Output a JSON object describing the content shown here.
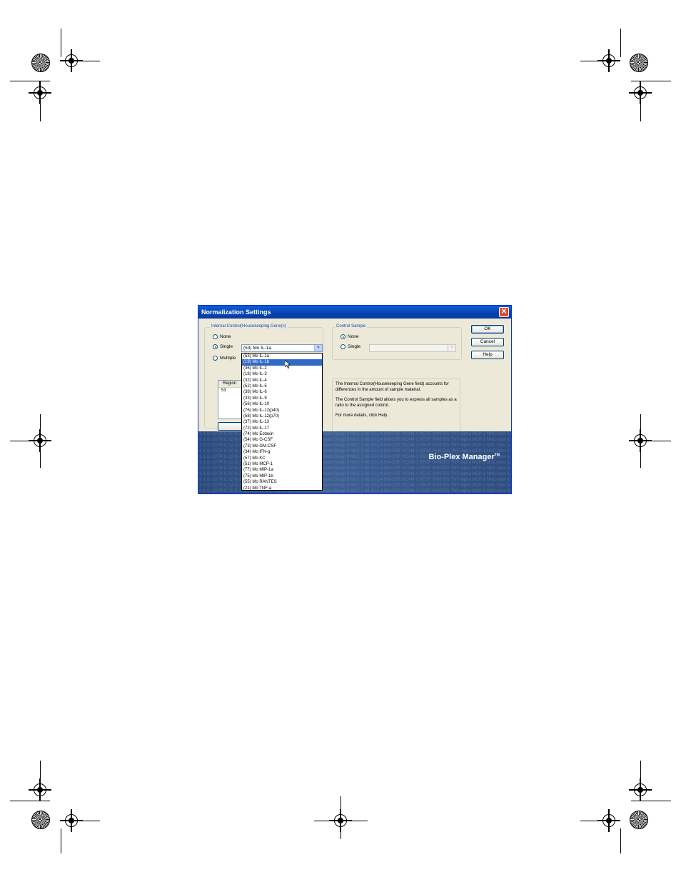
{
  "dialog": {
    "title": "Normalization Settings",
    "close_glyph": "✕"
  },
  "internal_control": {
    "group_label": "Internal Control(Housekeeping Gene(s)",
    "options": [
      "None",
      "Single",
      "Multiple"
    ],
    "selected": "Single",
    "combo_value": "(53)  Mo IL-1a",
    "list_header": "Region",
    "list_rows": [
      "53"
    ]
  },
  "control_sample": {
    "group_label": "Control Sample",
    "options": [
      "None",
      "Single"
    ],
    "selected": "None"
  },
  "buttons": {
    "ok": "OK",
    "cancel": "Cancel",
    "help": "Help"
  },
  "info_text": {
    "p1": "The Internal Control(Housekeeping Gene field) accounts for differences in the amount of sample material.",
    "p2": "The Control Sample field allows you to express all samples as a ratio to the assigned control.",
    "p3": "For more details, click Help."
  },
  "dropdown": {
    "selected_index": 1,
    "items": [
      "(53)  Mo IL-1a",
      "(19)  Mo IL-1b",
      "(36)  Mo IL-2",
      "(18)  Mo IL-3",
      "(32)  Mo IL-4",
      "(52)  Mo IL-5",
      "(38)  Mo IL-6",
      "(33)  Mo IL-9",
      "(56)  Mo IL-10",
      "(76)  Mo IL-12(p40)",
      "(58)  Mo IL-12(p70)",
      "(37)  Mo IL-13",
      "(72)  Mo IL-17",
      "(74)  Mo Eotaxin",
      "(54)  Mo G-CSF",
      "(73)  Mo GM-CSF",
      "(34)  Mo IFN-g",
      "(57)  Mo KC",
      "(51)  Mo MCP-1",
      "(77)  Mo MIP-1a",
      "(75)  Mo MIP-1b",
      "(55)  Mo RANTES",
      "(21)  Mo TNF-a"
    ]
  },
  "banner": {
    "brand": "Bio-Plex Manager",
    "trademark": "TM",
    "background_text": "IL-1 IL-10TR IL-12 IL-5 IL-4 IL-8 IL-10TR IL-12 p70 IL-13 IL-17 Eotaxin Group II NNC 1 ML-5 IL-4 GM-CSF VCAM-1 VEGF RANTES TNF-alpha MCP-1 NNC-beta IL-6 IL-3 IL-1a Group II CD40 IP-10 MIP-1b GRO-alpha PDGF-BB"
  },
  "colors": {
    "title_bar": "#0a4fc8",
    "dialog_face": "#ece9d8",
    "group_label": "#1a46b8",
    "selection": "#316ac5",
    "banner": "#3d5f93"
  }
}
